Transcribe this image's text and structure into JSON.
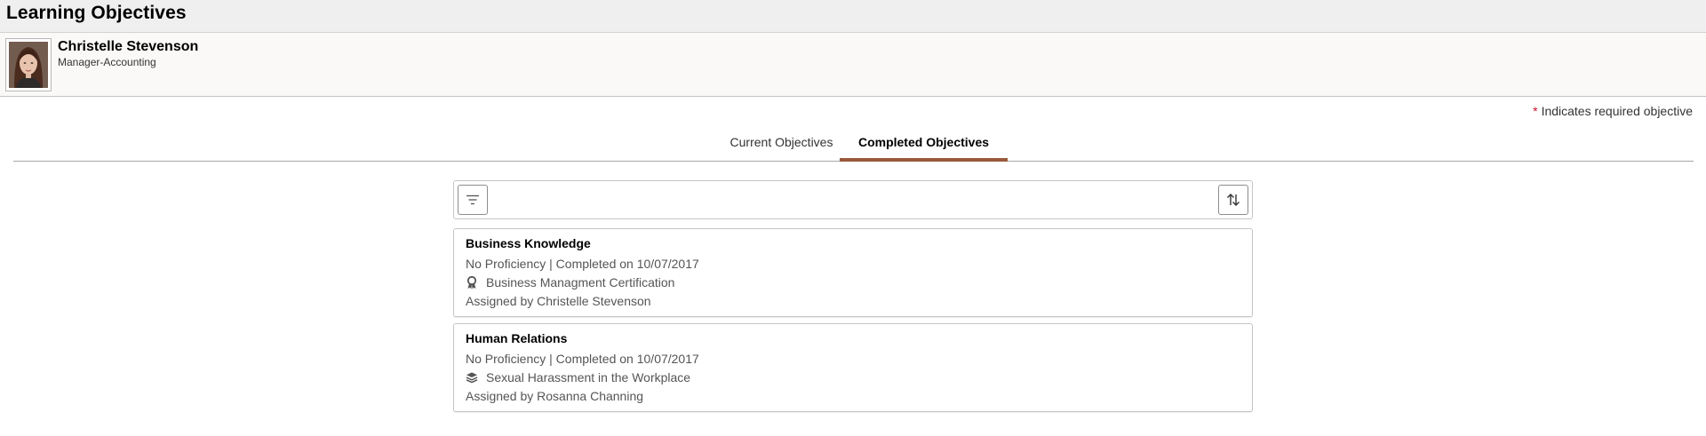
{
  "page": {
    "title": "Learning Objectives"
  },
  "person": {
    "name": "Christelle Stevenson",
    "role": "Manager-Accounting"
  },
  "required_note": {
    "star": "*",
    "text": "Indicates required objective"
  },
  "tabs": [
    {
      "label": "Current Objectives",
      "active": false
    },
    {
      "label": "Completed Objectives",
      "active": true
    }
  ],
  "toolbar": {
    "filter_icon": "filter-icon",
    "sort_icon": "sort-icon"
  },
  "objectives": [
    {
      "title": "Business Knowledge",
      "status": "No Proficiency | Completed on 10/07/2017",
      "course_icon": "award-ribbon-icon",
      "course": "Business Managment Certification",
      "assigned": "Assigned by Christelle Stevenson"
    },
    {
      "title": "Human Relations",
      "status": "No Proficiency | Completed on 10/07/2017",
      "course_icon": "books-stack-icon",
      "course": "Sexual Harassment in the Workplace",
      "assigned": "Assigned by Rosanna Channing"
    }
  ],
  "colors": {
    "header_bg": "#f0efef",
    "active_tab_underline": "#99593a",
    "required_star": "#c8102e",
    "card_border": "#c5c5c5"
  }
}
